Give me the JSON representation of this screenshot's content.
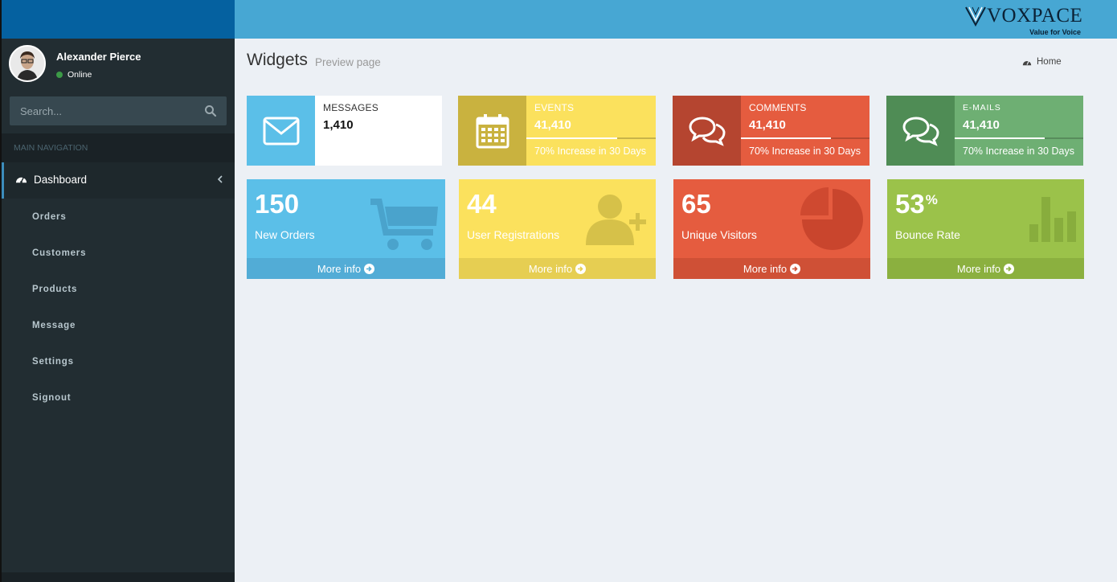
{
  "brand": {
    "logo_text": "VOXPACE",
    "tagline": "Value for Voice"
  },
  "user": {
    "name": "Alexander Pierce",
    "status": "Online"
  },
  "search": {
    "placeholder": "Search..."
  },
  "sidebar": {
    "header": "MAIN NAVIGATION",
    "active_item": "Dashboard",
    "items": [
      "Orders",
      "Customers",
      "Products",
      "Message",
      "Settings",
      "Signout"
    ]
  },
  "page": {
    "title": "Widgets",
    "subtitle": "Preview page",
    "breadcrumb": "Home"
  },
  "info_boxes": [
    {
      "label": "MESSAGES",
      "number": "1,410",
      "icon": "envelope-icon",
      "icon_bg": "#5bbfe8",
      "bg": "#ffffff"
    },
    {
      "label": "EVENTS",
      "number": "41,410",
      "progress": 0.7,
      "description": "70% Increase in 30 Days",
      "icon": "calendar-icon",
      "icon_bg": "#c9b23f",
      "bg": "#fbe15d"
    },
    {
      "label": "COMMENTS",
      "number": "41,410",
      "progress": 0.7,
      "description": "70% Increase in 30 Days",
      "icon": "comments-icon",
      "icon_bg": "#b54530",
      "bg": "#e55c3f"
    },
    {
      "label": "E-MAILS",
      "number": "41,410",
      "progress": 0.7,
      "description": "70% Increase in 30 Days",
      "icon": "comments-icon",
      "icon_bg": "#4f8c55",
      "bg": "#6eaf73"
    }
  ],
  "small_boxes": [
    {
      "value": "150",
      "suffix": "",
      "label": "New Orders",
      "footer": "More info",
      "icon": "cart-icon",
      "bg": "#5bbfe8"
    },
    {
      "value": "44",
      "suffix": "",
      "label": "User Registrations",
      "footer": "More info",
      "icon": "user-add-icon",
      "bg": "#fbe15d"
    },
    {
      "value": "65",
      "suffix": "",
      "label": "Unique Visitors",
      "footer": "More info",
      "icon": "pie-chart-icon",
      "bg": "#e55c3f"
    },
    {
      "value": "53",
      "suffix": "%",
      "label": "Bounce Rate",
      "footer": "More info",
      "icon": "bar-chart-icon",
      "bg": "#9bc24a"
    }
  ]
}
